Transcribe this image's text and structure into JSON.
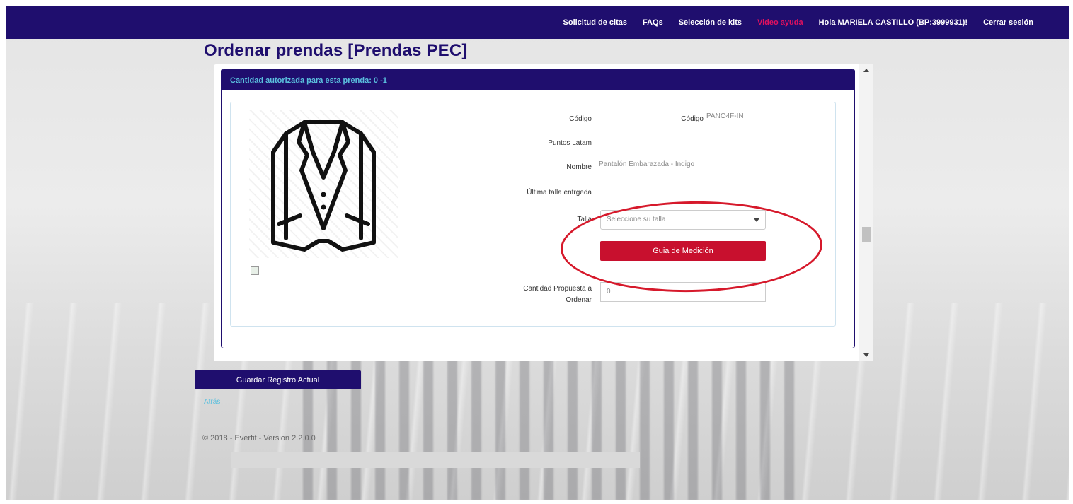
{
  "nav": {
    "items": [
      {
        "label": "Solicitud de citas",
        "active": false
      },
      {
        "label": "FAQs",
        "active": false
      },
      {
        "label": "Selección de kits",
        "active": false
      },
      {
        "label": "Video ayuda",
        "active": true
      },
      {
        "label": "Hola MARIELA CASTILLO (BP:3999931)!",
        "active": false
      },
      {
        "label": "Cerrar sesión",
        "active": false
      }
    ]
  },
  "page": {
    "title": "Ordenar prendas [Prendas PEC]"
  },
  "card": {
    "header": "Cantidad autorizada para esta prenda: 0 -1",
    "fields": {
      "codigo_label": "Código",
      "codigo_label_2": "Código",
      "codigo_value": "PANO4F-IN",
      "puntos_label": "Puntos Latam",
      "nombre_label": "Nombre",
      "nombre_value": "Pantalón Embarazada - Indigo",
      "ultima_talla_label": "Última talla entrgeda",
      "talla_label": "Talla",
      "talla_placeholder": "Seleccione su talla",
      "guide_button": "Guia de Medición",
      "cantidad_label_1": "Cantidad Propuesta a",
      "cantidad_label_2": "Ordenar",
      "cantidad_value": "0"
    }
  },
  "actions": {
    "save_button": "Guardar Registro Actual",
    "back_link": "Atrás"
  },
  "footer": {
    "text": "© 2018 - Everfit - Version 2.2.0.0"
  },
  "colors": {
    "navbar": "#1f0e6e",
    "active_nav": "#e0115f",
    "guide_button": "#c8102e",
    "highlight": "#d6192b"
  },
  "icons": {
    "garment": "jacket-icon",
    "broken_image": "broken-image-icon"
  }
}
